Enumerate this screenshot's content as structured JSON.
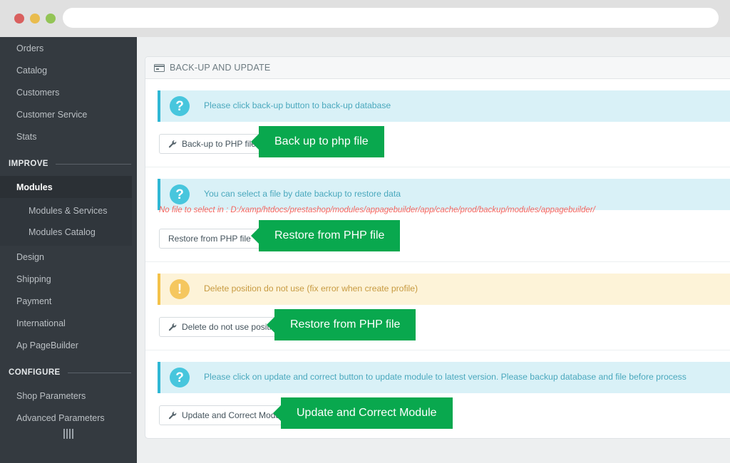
{
  "browser": {
    "url_value": "",
    "url_placeholder": "",
    "dots": [
      "close-red",
      "minimize-yellow",
      "maximize-green"
    ]
  },
  "sidebar": {
    "items": [
      {
        "label": "Orders",
        "type": "link",
        "active": false
      },
      {
        "label": "Catalog",
        "type": "link",
        "active": false
      },
      {
        "label": "Customers",
        "type": "link",
        "active": false
      },
      {
        "label": "Customer Service",
        "type": "link",
        "active": false
      },
      {
        "label": "Stats",
        "type": "link",
        "active": false
      }
    ],
    "improve_section": "IMPROVE",
    "improve_items": [
      {
        "label": "Modules",
        "active": true
      },
      {
        "label": "Design",
        "active": false
      },
      {
        "label": "Shipping",
        "active": false
      },
      {
        "label": "Payment",
        "active": false
      },
      {
        "label": "International",
        "active": false
      },
      {
        "label": "Ap PageBuilder",
        "active": false
      }
    ],
    "modules_submenu": [
      {
        "label": "Modules & Services"
      },
      {
        "label": "Modules Catalog"
      }
    ],
    "configure_section": "CONFIGURE",
    "configure_items": [
      {
        "label": "Shop Parameters"
      },
      {
        "label": "Advanced Parameters"
      }
    ],
    "collapse_icon": "collapse-menu-icon"
  },
  "panel": {
    "header_icon": "credit-card-icon",
    "header_title": "BACK-UP AND UPDATE"
  },
  "sections": [
    {
      "alert_type": "info",
      "alert_icon": "question-mark-icon",
      "alert_text": "Please click back-up button to back-up database",
      "button_icon": "wrench-icon",
      "button_label": "Back-up to PHP file",
      "callout_label": "Back up to php file",
      "error_text": ""
    },
    {
      "alert_type": "info",
      "alert_icon": "question-mark-icon",
      "alert_text": "You can select a file by date backup to restore data",
      "button_icon": "",
      "button_label": "Restore from PHP file",
      "callout_label": "Restore from PHP file",
      "error_text": "No file to select in : D:/xamp/htdocs/prestashop/modules/appagebuilder/app/cache/prod/backup/modules/appagebuilder/"
    },
    {
      "alert_type": "warning",
      "alert_icon": "exclamation-mark-icon",
      "alert_text": "Delete position do not use (fix error when create profile)",
      "button_icon": "wrench-icon",
      "button_label": "Delete do not use position",
      "callout_label": "Restore from PHP file",
      "error_text": ""
    },
    {
      "alert_type": "info",
      "alert_icon": "question-mark-icon",
      "alert_text": "Please click on update and correct button to update module to latest version. Please backup database and file before process",
      "button_icon": "wrench-icon",
      "button_label": "Update and Correct Module",
      "callout_label": "Update and Correct Module",
      "error_text": ""
    }
  ],
  "colors": {
    "accent_green": "#09a84e",
    "info_bg": "#d9f1f7",
    "info_icon": "#47c6dd",
    "warning_bg": "#fdf3d8",
    "warning_icon": "#f5c75f",
    "error_text": "#f4655f",
    "sidebar_bg": "#343a40"
  }
}
